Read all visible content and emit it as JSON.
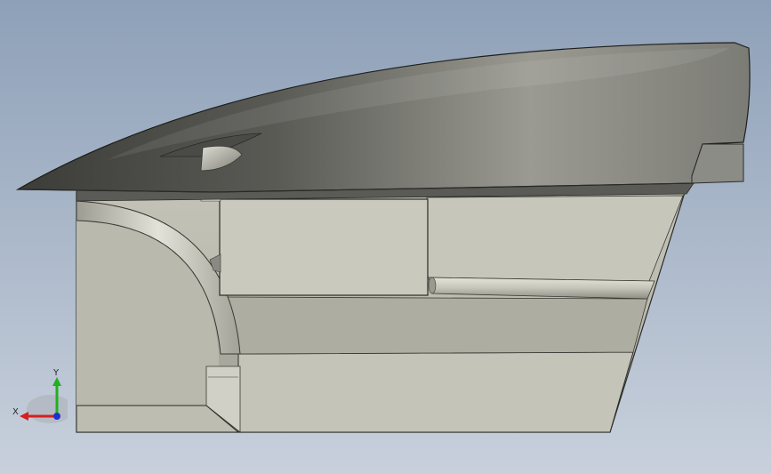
{
  "viewport": {
    "background_top": "#8ea0b8",
    "background_bottom": "#c8d0dc"
  },
  "triad": {
    "x_label": "X",
    "y_label": "Y",
    "x_color": "#d42020",
    "y_color": "#20b020",
    "z_color": "#2030d0"
  }
}
